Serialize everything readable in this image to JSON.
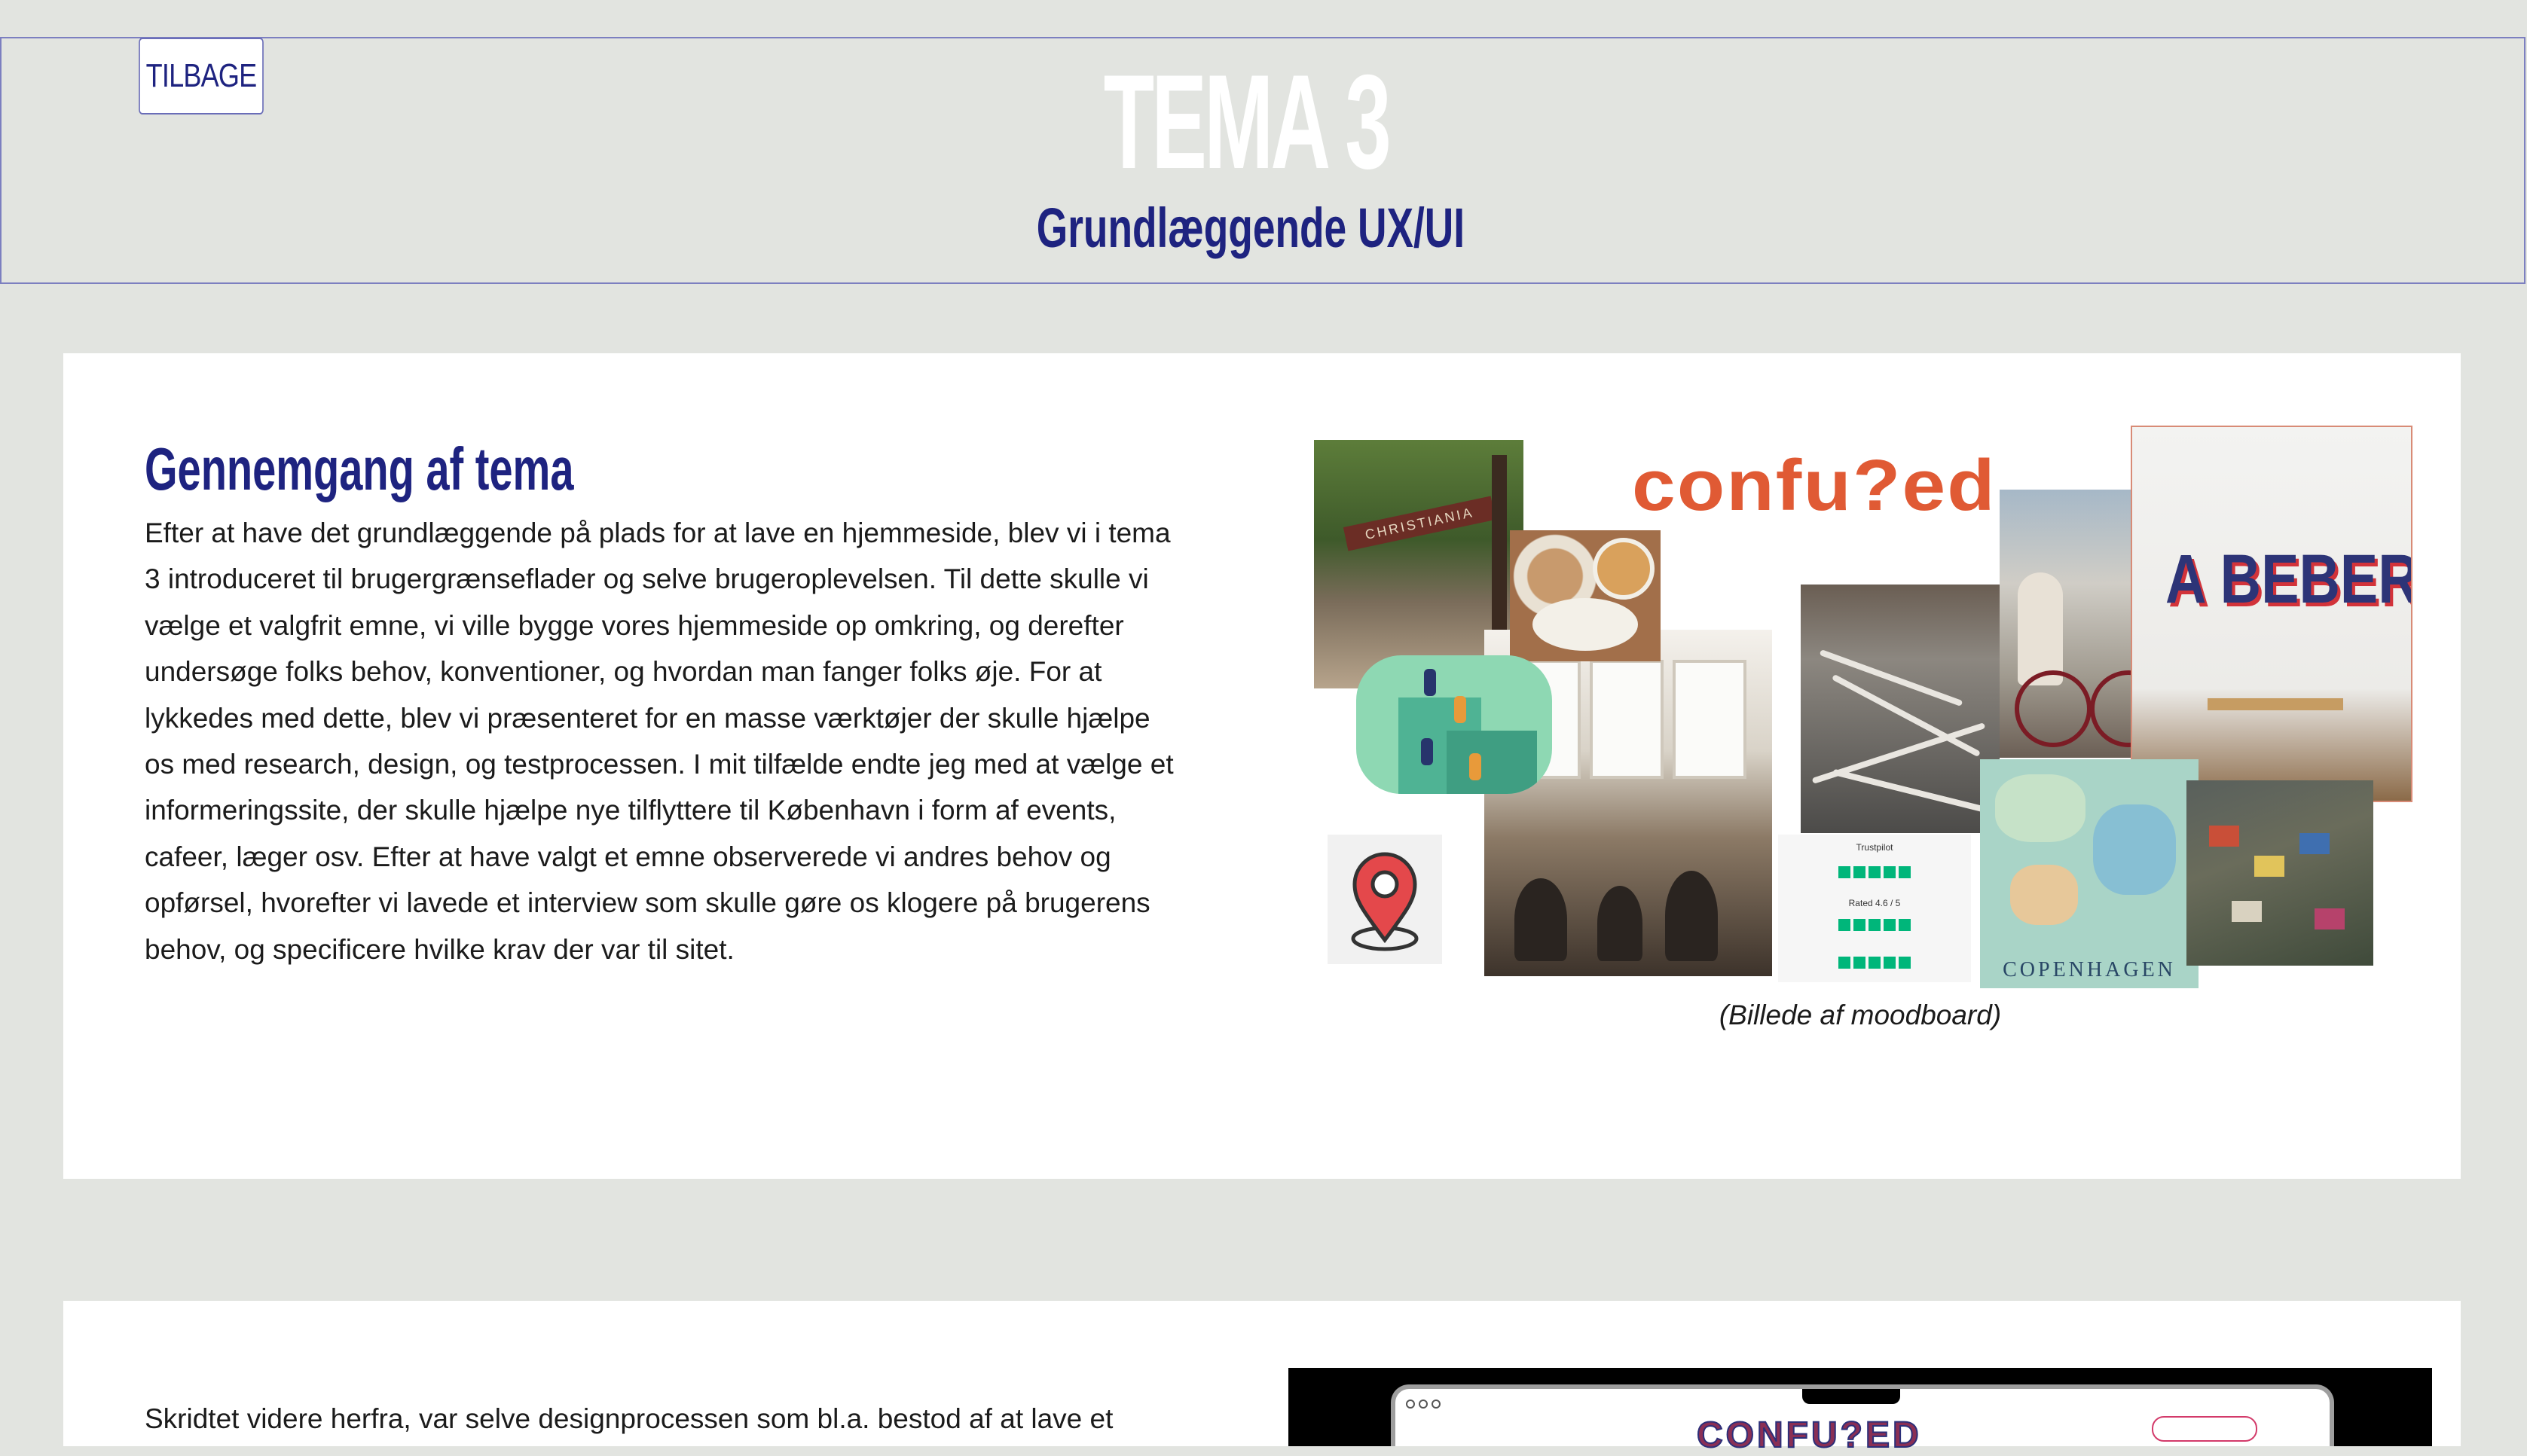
{
  "header": {
    "back_label": "TILBAGE",
    "title": "TEMA 3",
    "subtitle": "Grundlæggende UX/UI"
  },
  "section1": {
    "heading": "Gennemgang af tema",
    "body": "Efter at have det grundlæggende på plads for at lave en hjemmeside, blev vi i tema 3 introduceret til brugergrænseflader og selve brugeroplevelsen. Til dette skulle vi vælge et valgfrit emne, vi ville bygge vores hjemmeside op omkring, og derefter undersøge folks behov, konventioner, og hvordan man fanger folks øje. For at lykkedes med dette, blev vi præsenteret for en masse værktøjer der skulle hjælpe os med research, design, og testprocessen. I mit tilfælde endte jeg med at vælge et informeringssite, der skulle hjælpe nye tilflyttere til København i form af events, cafeer, læger osv. Efter at have valgt et emne observerede vi andres behov og opførsel, hvorefter vi lavede et interview som skulle gøre os klogere på brugerens behov, og specificere hvilke krav der var til sitet.",
    "moodboard": {
      "caption": "(Billede af moodboard)",
      "logo_text": "confu?ed",
      "christiania_sign": "CHRISTIANIA",
      "cafe_sign": "A BEBER",
      "map_title": "COPENHAGEN",
      "trustpilot_label": "Trustpilot",
      "trustpilot_rated": "Rated 4.6 / 5"
    }
  },
  "section2": {
    "body": "Skridtet videre herfra, var selve designprocessen som bl.a. bestod af at lave et",
    "laptop_logo": "CONFU?ED"
  },
  "colors": {
    "background": "#e2e4e0",
    "accent_navy": "#1e2380",
    "logo_orange": "#e05a34"
  }
}
